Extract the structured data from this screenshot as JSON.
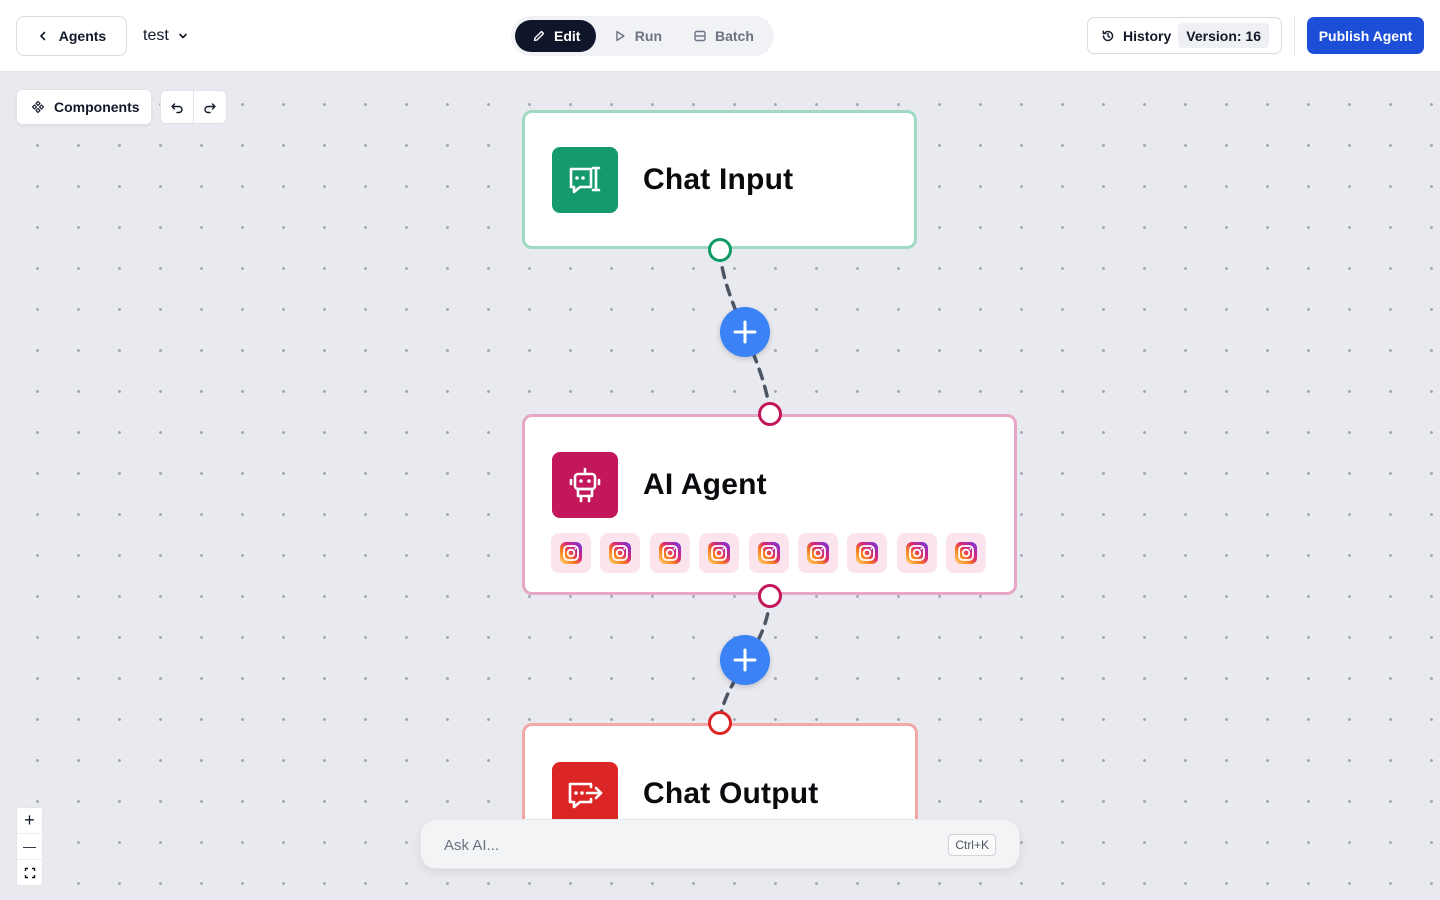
{
  "header": {
    "back_label": "Agents",
    "agent_name": "test",
    "modes": [
      {
        "label": "Edit",
        "active": true
      },
      {
        "label": "Run",
        "active": false
      },
      {
        "label": "Batch",
        "active": false
      }
    ],
    "history_label": "History",
    "version_label": "Version: 16",
    "publish_label": "Publish Agent"
  },
  "canvas_toolbar": {
    "components_label": "Components",
    "undo_icon": "undo-icon",
    "redo_icon": "redo-icon"
  },
  "nodes": {
    "chat_input": {
      "title": "Chat Input",
      "icon": "chat-input-icon",
      "color": "#149a6b"
    },
    "ai_agent": {
      "title": "AI Agent",
      "icon": "robot-icon",
      "color": "#c2185b",
      "tools": [
        "instagram-icon",
        "instagram-icon",
        "instagram-icon",
        "instagram-icon",
        "instagram-icon",
        "instagram-icon",
        "instagram-icon",
        "instagram-icon",
        "instagram-icon"
      ]
    },
    "chat_output": {
      "title": "Chat Output",
      "icon": "chat-output-icon",
      "color": "#dc2626"
    }
  },
  "zoom": {
    "zoom_in": "+",
    "zoom_out": "—",
    "fit_icon": "fit-view-icon"
  },
  "ask_ai": {
    "placeholder": "Ask AI...",
    "shortcut": "Ctrl+K"
  },
  "colors": {
    "accent": "#1d4ed8",
    "add_button": "#3b82f6",
    "edit_active": "#0f1629"
  }
}
